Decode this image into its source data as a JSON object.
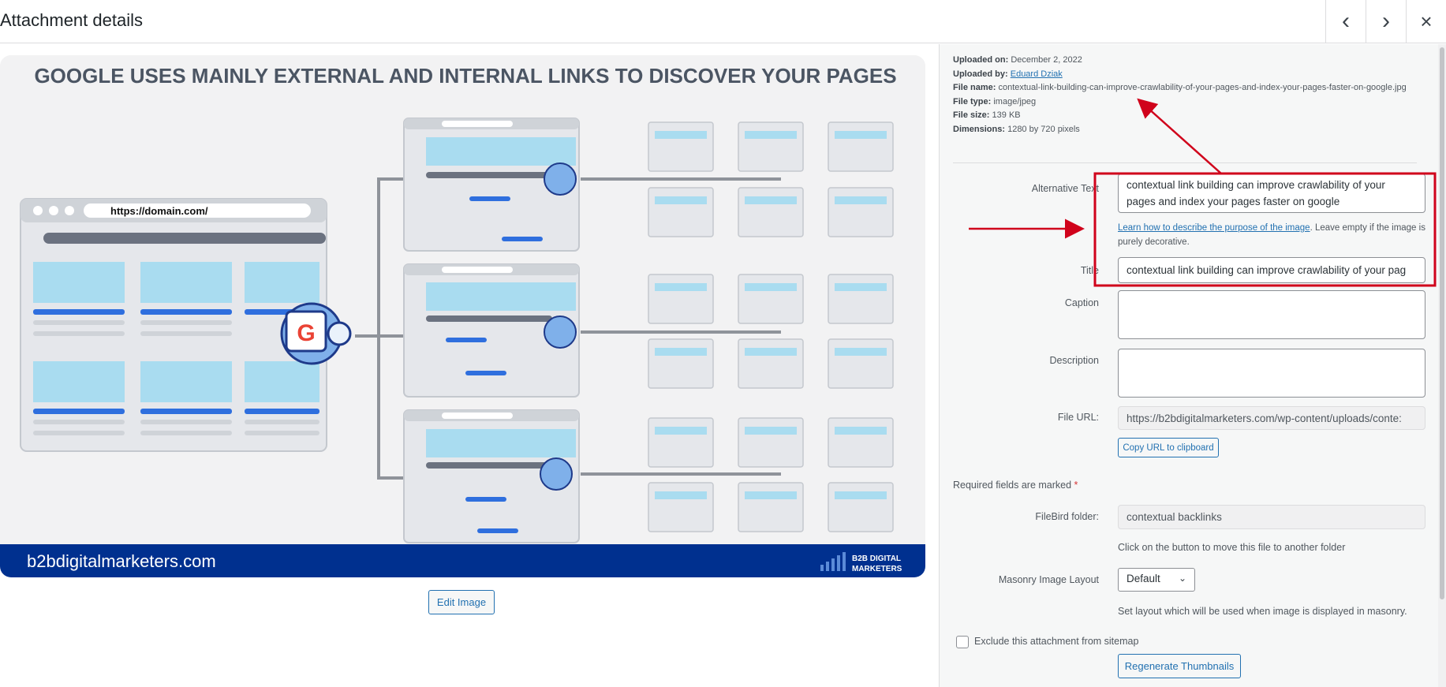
{
  "header": {
    "title": "Attachment details",
    "prev_icon": "‹",
    "next_icon": "›",
    "close_icon": "×"
  },
  "image": {
    "headline": "GOOGLE USES MAINLY EXTERNAL AND INTERNAL LINKS TO DISCOVER YOUR PAGES",
    "main_url": "https://domain.com/",
    "small_url": "https://domain.com/",
    "footer_site": "b2bdigitalmarketers.com",
    "logo_line1": "B2B DIGITAL",
    "logo_line2": "MARKETERS",
    "colors": {
      "footer_bar": "#00308f",
      "spider": "#3a7bd5",
      "light_blue": "#a9dcf0",
      "accent_blue": "#2f6fde"
    }
  },
  "edit_image_label": "Edit Image",
  "meta": {
    "uploaded_on_label": "Uploaded on:",
    "uploaded_on": "December 2, 2022",
    "uploaded_by_label": "Uploaded by:",
    "uploaded_by": "Eduard Dziak",
    "file_name_label": "File name:",
    "file_name": "contextual-link-building-can-improve-crawlability-of-your-pages-and-index-your-pages-faster-on-google.jpg",
    "file_type_label": "File type:",
    "file_type": "image/jpeg",
    "file_size_label": "File size:",
    "file_size": "139 KB",
    "dimensions_label": "Dimensions:",
    "dimensions": "1280 by 720 pixels"
  },
  "form": {
    "alt_label": "Alternative Text",
    "alt_value": "contextual link building can improve crawlability of your pages and index your pages faster on google",
    "alt_help_link": "Learn how to describe the purpose of the image",
    "alt_help_rest": ". Leave empty if the image is purely decorative.",
    "title_label": "Title",
    "title_value": "contextual link building can improve crawlability of your pag",
    "caption_label": "Caption",
    "caption_value": "",
    "description_label": "Description",
    "description_value": "",
    "file_url_label": "File URL:",
    "file_url_value": "https://b2bdigitalmarketers.com/wp-content/uploads/conte:",
    "copy_url_label": "Copy URL to clipboard",
    "required_note": "Required fields are marked ",
    "required_star": "*",
    "filebird_label": "FileBird folder:",
    "filebird_value": "contextual backlinks",
    "filebird_help": "Click on the button to move this file to another folder",
    "masonry_label": "Masonry Image Layout",
    "masonry_value": "Default",
    "masonry_help": "Set layout which will be used when image is displayed in masonry.",
    "exclude_label": "Exclude this attachment from sitemap",
    "regen_label": "Regenerate Thumbnails"
  },
  "annotation_color": "#d0021b"
}
